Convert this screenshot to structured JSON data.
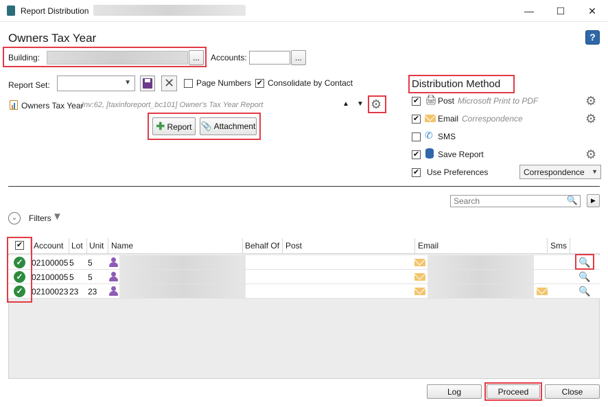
{
  "window": {
    "title": "Report Distribution",
    "minimize_icon": "minimize-icon",
    "maximize_icon": "maximize-icon",
    "close_icon": "close-icon"
  },
  "header": {
    "title": "Owners Tax Year",
    "help_icon": "?"
  },
  "building": {
    "label": "Building:",
    "browse": "..."
  },
  "accounts": {
    "label": "Accounts:",
    "browse": "..."
  },
  "report_set": {
    "label": "Report Set:",
    "page_numbers_label": "Page Numbers",
    "page_numbers_checked": false,
    "consolidate_label": "Consolidate by Contact",
    "consolidate_checked": true
  },
  "report_item": {
    "name": "Owners Tax Year",
    "details": "Inv:62, [taxinforeport_bc101] Owner's Tax Year Report",
    "up": "▲",
    "down": "▼"
  },
  "add_buttons": {
    "report": "Report",
    "attachment": "Attachment"
  },
  "distribution": {
    "title": "Distribution Method",
    "methods": [
      {
        "label": "Post",
        "detail": "Microsoft Print to PDF",
        "checked": true
      },
      {
        "label": "Email",
        "detail": "Correspondence",
        "checked": true
      },
      {
        "label": "SMS",
        "detail": "",
        "checked": false
      },
      {
        "label": "Save Report",
        "detail": "",
        "checked": true
      }
    ],
    "use_preferences_label": "Use Preferences",
    "use_preferences_checked": true,
    "preferences_value": "Correspondence"
  },
  "search": {
    "placeholder": "Search"
  },
  "filters": {
    "label": "Filters"
  },
  "table": {
    "columns": [
      "Account",
      "Lot",
      "Unit",
      "Name",
      "Behalf Of",
      "Post",
      "Email",
      "Sms"
    ],
    "rows": [
      {
        "account": "02100005",
        "lot": "5",
        "unit": "5"
      },
      {
        "account": "02100005",
        "lot": "5",
        "unit": "5"
      },
      {
        "account": "02100023",
        "lot": "23",
        "unit": "23"
      }
    ]
  },
  "footer": {
    "log": "Log",
    "proceed": "Proceed",
    "close": "Close"
  },
  "colors": {
    "accent_red": "#e23a44",
    "ok_green": "#2e8b3e",
    "person_purple": "#8e5bb5",
    "mail_yellow": "#f2c46b"
  }
}
